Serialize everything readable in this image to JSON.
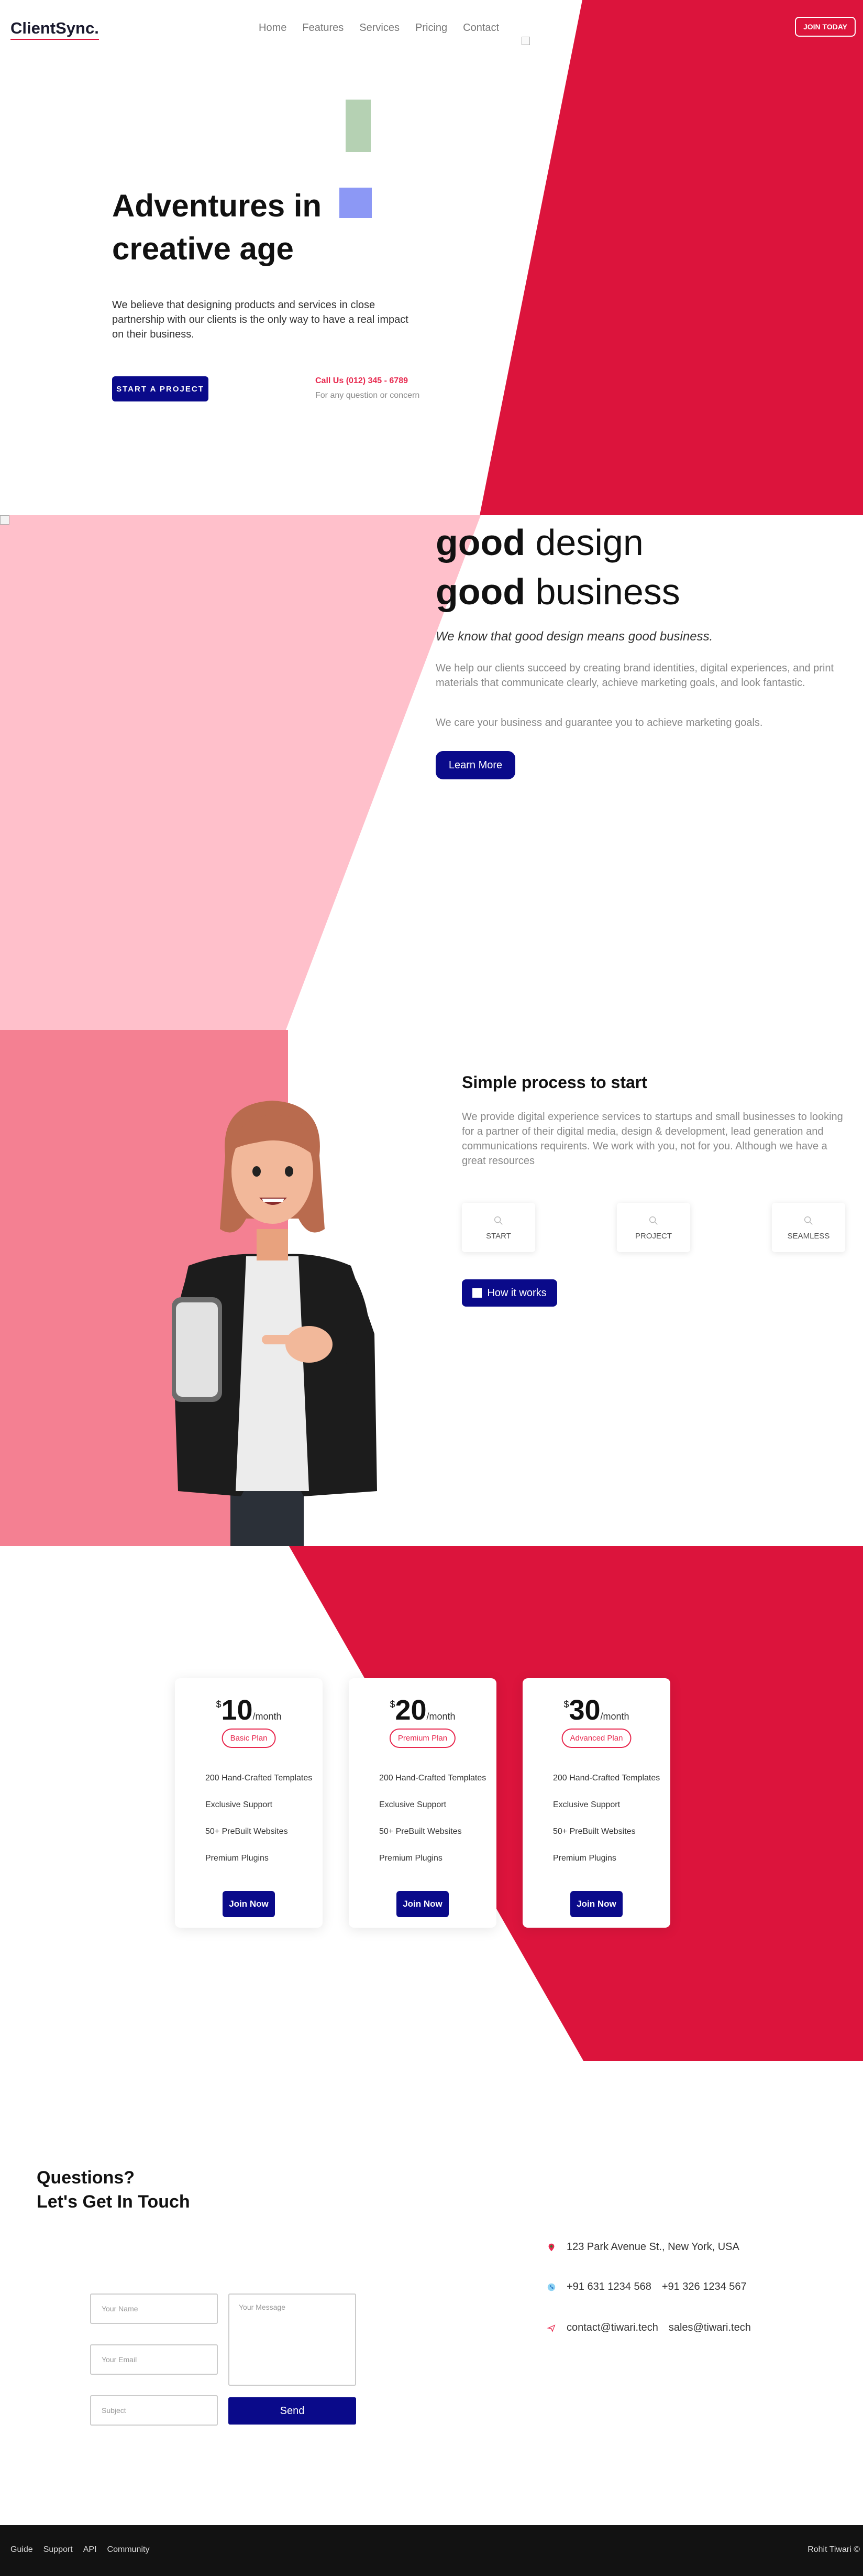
{
  "nav": {
    "logo": "ClientSync.",
    "links": [
      "Home",
      "Features",
      "Services",
      "Pricing",
      "Contact"
    ],
    "join_label": "JOIN TODAY"
  },
  "hero": {
    "title": "Adventures in creative age",
    "description": "We believe that designing products and services in close partnership with our clients is the only way to have a real impact on their business.",
    "cta_label": "START A PROJECT",
    "call_label": "Call Us (012) 345 - 6789",
    "call_note": "For any question or concern"
  },
  "good": {
    "line1_bold": "good",
    "line1_rest": " design",
    "line2_bold": "good",
    "line2_rest": " business",
    "tagline": "We know that good design means good business.",
    "paragraph1": "We help our clients succeed by creating brand identities, digital experiences, and print materials that communicate clearly, achieve marketing goals, and look fantastic.",
    "paragraph2": "We care your business and guarantee you to achieve marketing goals.",
    "button_label": "Learn More"
  },
  "process": {
    "title": "Simple process to start",
    "description": "We provide digital experience services to startups and small businesses to looking for a partner of their digital media, design & development, lead generation and communications requirents. We work with you, not for you. Although we have a great resources",
    "steps": [
      "START",
      "PROJECT",
      "SEAMLESS"
    ],
    "button_label": "How it works"
  },
  "pricing": {
    "plans": [
      {
        "currency": "$",
        "amount": "10",
        "period": "/month",
        "badge": "Basic Plan",
        "features": [
          "200 Hand-Crafted Templates",
          "Exclusive Support",
          "50+ PreBuilt Websites",
          "Premium Plugins"
        ],
        "button": "Join Now"
      },
      {
        "currency": "$",
        "amount": "20",
        "period": "/month",
        "badge": "Premium Plan",
        "features": [
          "200 Hand-Crafted Templates",
          "Exclusive Support",
          "50+ PreBuilt Websites",
          "Premium Plugins"
        ],
        "button": "Join Now"
      },
      {
        "currency": "$",
        "amount": "30",
        "period": "/month",
        "badge": "Advanced Plan",
        "features": [
          "200 Hand-Crafted Templates",
          "Exclusive Support",
          "50+ PreBuilt Websites",
          "Premium Plugins"
        ],
        "button": "Join Now"
      }
    ]
  },
  "contact": {
    "title_line1": "Questions?",
    "title_line2": "Let's Get In Touch",
    "name_placeholder": "Your Name",
    "email_placeholder": "Your Email",
    "subject_placeholder": "Subject",
    "message_placeholder": "Your Message",
    "send_label": "Send",
    "address": "123 Park Avenue St., New York, USA",
    "phone1": "+91 631 1234 568",
    "phone2": "+91 326 1234 567",
    "email1": "contact@tiwari.tech",
    "email2": "sales@tiwari.tech"
  },
  "footer": {
    "links": [
      "Guide",
      "Support",
      "API",
      "Community"
    ],
    "copyright": "Rohit Tiwari ©"
  },
  "colors": {
    "crimson": "#dc143c",
    "pink_light": "#ffc0cb",
    "pink_mid": "#f48092",
    "navy": "#0a0a8a",
    "footer_bg": "#121212"
  }
}
